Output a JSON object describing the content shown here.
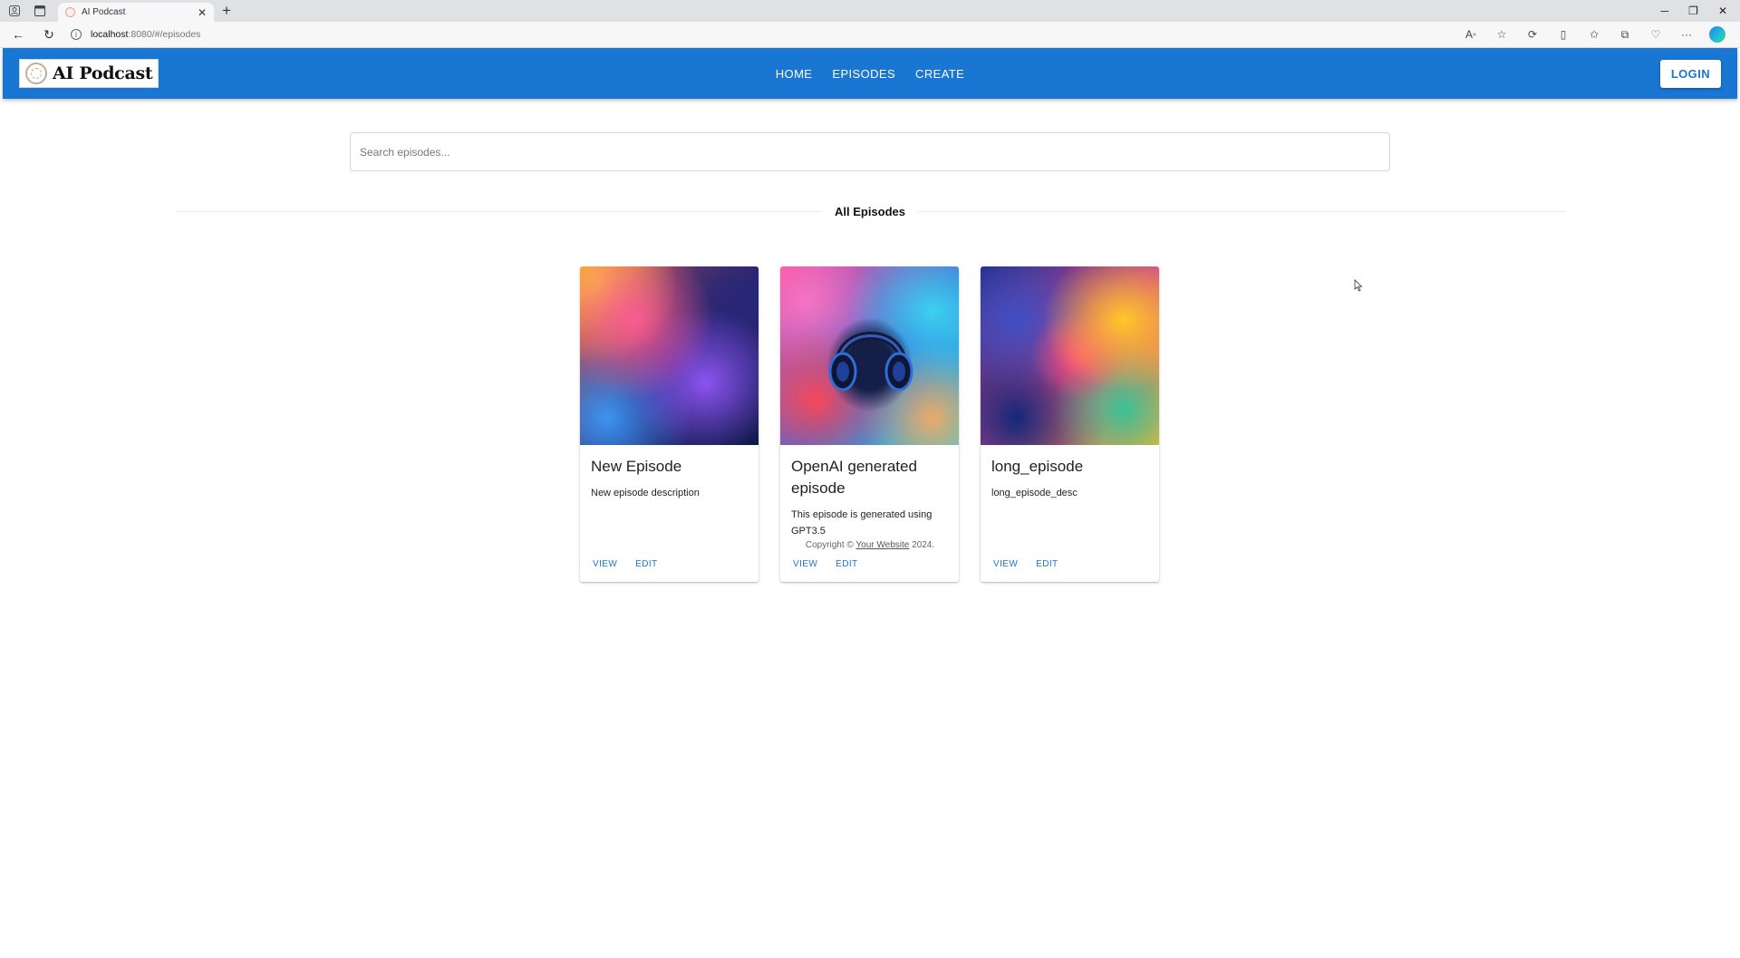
{
  "browser": {
    "tab_title": "AI Podcast",
    "url_host": "localhost",
    "url_path": ":8080/#/episodes"
  },
  "app": {
    "logo_text": "AI Podcast",
    "nav": [
      "HOME",
      "EPISODES",
      "CREATE"
    ],
    "login_label": "LOGIN",
    "search_placeholder": "Search episodes...",
    "section_title": "All Episodes",
    "episodes": [
      {
        "title": "New Episode",
        "description": "New episode description",
        "view_label": "VIEW",
        "edit_label": "EDIT"
      },
      {
        "title": "OpenAI generated episode",
        "description": "This episode is generated using GPT3.5",
        "view_label": "VIEW",
        "edit_label": "EDIT"
      },
      {
        "title": "long_episode",
        "description": "long_episode_desc",
        "view_label": "VIEW",
        "edit_label": "EDIT"
      }
    ],
    "footer": {
      "prefix": "Copyright © ",
      "link": "Your Website",
      "suffix": " 2024."
    }
  },
  "colors": {
    "primary": "#1976d2",
    "background": "#ffffff"
  }
}
